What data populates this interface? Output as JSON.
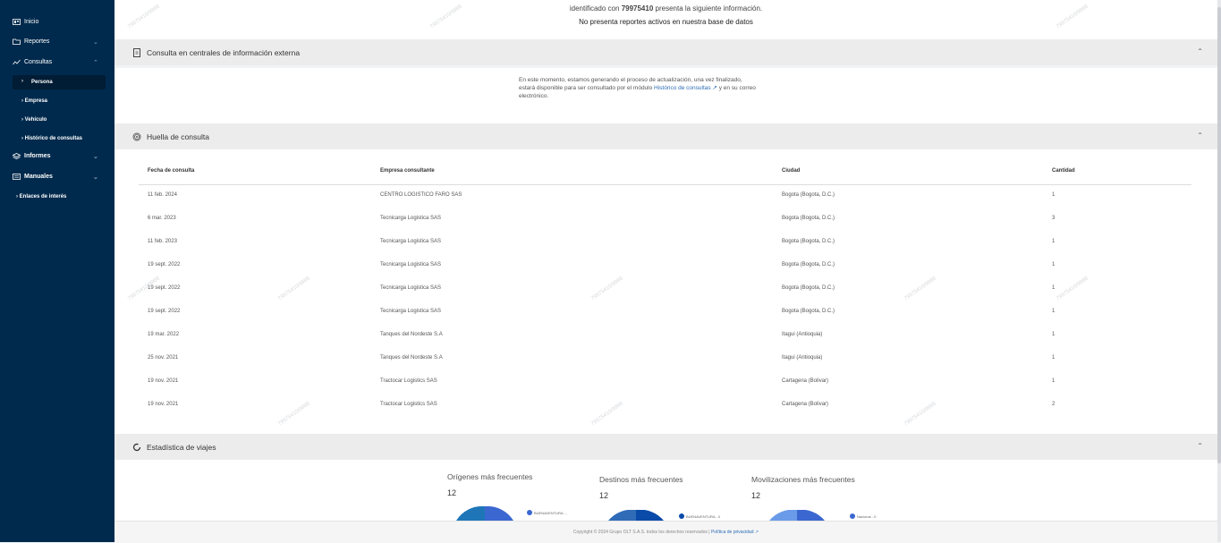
{
  "sidebar": {
    "inicio": "Inicio",
    "reportes": "Reportes",
    "consultas": "Consultas",
    "persona": "Persona",
    "empresa": "Empresa",
    "vehiculo": "Vehículo",
    "historico": "Histórico de consultas",
    "informes": "Informes",
    "manuales": "Manuales",
    "enlaces": "Enlaces de interés"
  },
  "top": {
    "line1_pre": "identificado con ",
    "line1_id": "79975410",
    "line1_post": " presenta la siguiente información.",
    "line2": "No presenta reportes activos en nuestra base de datos"
  },
  "external": {
    "title": "Consulta en centrales de información externa",
    "text_1": "En este momento, estamos generando el proceso de actualización, una vez finalizado,",
    "text_2": "estará disponible para ser consultado por el módulo ",
    "link": "Histórico de consultas ↗",
    "text_3": " y en su correo",
    "text_4": "electrónico."
  },
  "huella": {
    "title": "Huella de consulta",
    "headers": [
      "Fecha de consulta",
      "Empresa consultante",
      "Ciudad",
      "Cantidad"
    ],
    "rows": [
      [
        "11 feb. 2024",
        "CENTRO LOGISTICO FARO SAS",
        "Bogota (Bogota, D.C.)",
        "1"
      ],
      [
        "6 mar. 2023",
        "Tecnicarga Logistica SAS",
        "Bogota (Bogota, D.C.)",
        "3"
      ],
      [
        "11 feb. 2023",
        "Tecnicarga Logistica SAS",
        "Bogota (Bogota, D.C.)",
        "1"
      ],
      [
        "19 sept. 2022",
        "Tecnicarga Logistica SAS",
        "Bogota (Bogota, D.C.)",
        "1"
      ],
      [
        "19 sept. 2022",
        "Tecnicarga Logistica SAS",
        "Bogota (Bogota, D.C.)",
        "1"
      ],
      [
        "19 sept. 2022",
        "Tecnicarga Logistica SAS",
        "Bogota (Bogota, D.C.)",
        "1"
      ],
      [
        "19 mar. 2022",
        "Tanques del Nordeste S.A",
        "Itagui (Antioquia)",
        "1"
      ],
      [
        "25 nov. 2021",
        "Tanques del Nordeste S.A",
        "Itagui (Antioquia)",
        "1"
      ],
      [
        "19 nov. 2021",
        "Tractocar Logistics SAS",
        "Cartagena (Bolivar)",
        "1"
      ],
      [
        "19 nov. 2021",
        "Tractocar Logistics SAS",
        "Cartagena (Bolivar)",
        "2"
      ]
    ]
  },
  "stats": {
    "title": "Estadística de viajes",
    "origenes_title": "Orígenes más frecuentes",
    "origenes_count": "12",
    "origenes_legend": "BUENAVENTURA - -",
    "destinos_title": "Destinos más frecuentes",
    "destinos_count": "12",
    "destinos_legend": "BUENAVENTURA - 0",
    "mov_title": "Movilizaciones más frecuentes",
    "mov_count": "12",
    "mov_legend": "Nacional - 0"
  },
  "footer": {
    "copyright": "Copyright © 2024 Grupo OLT S.A.S. todos los derechos reservados  |  ",
    "privacy": "Política de privacidad ↗"
  },
  "watermark": "79975410/9988"
}
